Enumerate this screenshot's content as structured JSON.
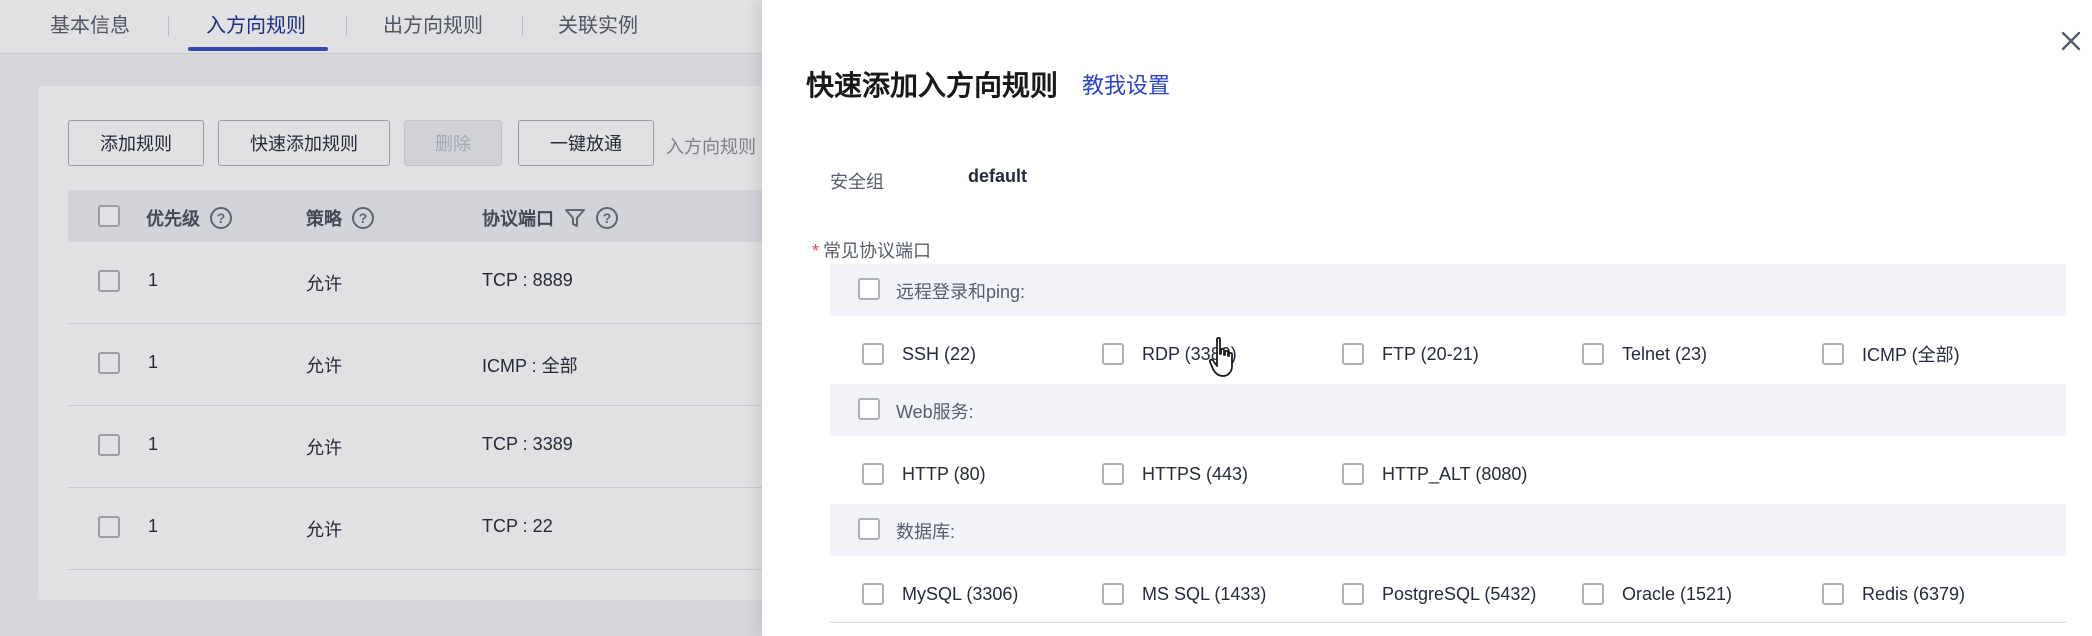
{
  "tabs": [
    {
      "label": "基本信息",
      "active": false
    },
    {
      "label": "入方向规则",
      "active": true
    },
    {
      "label": "出方向规则",
      "active": false
    },
    {
      "label": "关联实例",
      "active": false
    }
  ],
  "toolbar": {
    "add_rule": "添加规则",
    "quick_add_rule": "快速添加规则",
    "delete": "删除",
    "one_click_allow": "一键放通",
    "hint": "入方向规则"
  },
  "table": {
    "columns": {
      "priority": "优先级",
      "policy": "策略",
      "protocol_port": "协议端口"
    },
    "rows": [
      {
        "priority": "1",
        "policy": "允许",
        "protocol_port": "TCP : 8889"
      },
      {
        "priority": "1",
        "policy": "允许",
        "protocol_port": "ICMP : 全部"
      },
      {
        "priority": "1",
        "policy": "允许",
        "protocol_port": "TCP : 3389"
      },
      {
        "priority": "1",
        "policy": "允许",
        "protocol_port": "TCP : 22"
      }
    ]
  },
  "drawer": {
    "title": "快速添加入方向规则",
    "help_link": "教我设置",
    "security_group_label": "安全组",
    "security_group_value": "default",
    "common_ports_label": "常见协议端口",
    "required_mark": "*",
    "groups": [
      {
        "label": "远程登录和ping:",
        "options": [
          "SSH (22)",
          "RDP (3389)",
          "FTP (20-21)",
          "Telnet (23)",
          "ICMP (全部)"
        ]
      },
      {
        "label": "Web服务:",
        "options": [
          "HTTP (80)",
          "HTTPS (443)",
          "HTTP_ALT (8080)"
        ]
      },
      {
        "label": "数据库:",
        "options": [
          "MySQL (3306)",
          "MS SQL (1433)",
          "PostgreSQL (5432)",
          "Oracle (1521)",
          "Redis (6379)"
        ]
      }
    ]
  },
  "colors": {
    "accent": "#3b4fc1",
    "link": "#2a45c8",
    "required": "#e5484d",
    "group_bg": "#f1f3f8"
  },
  "icons": {
    "close": "close-icon",
    "help": "question-circle-icon",
    "filter": "filter-icon",
    "cursor": "hand-pointer-icon"
  }
}
